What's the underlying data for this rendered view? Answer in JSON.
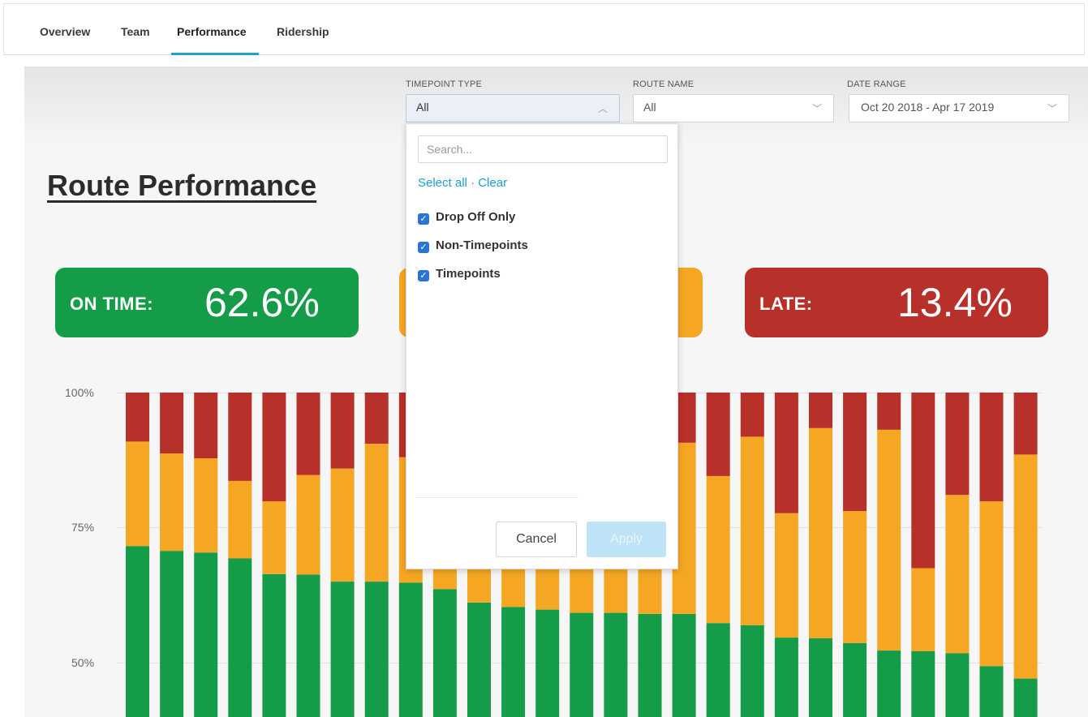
{
  "tabs": [
    {
      "label": "Overview"
    },
    {
      "label": "Team"
    },
    {
      "label": "Performance",
      "active": true
    },
    {
      "label": "Ridership"
    }
  ],
  "filters": {
    "timepoint": {
      "label": "TIMEPOINT TYPE",
      "value": "All"
    },
    "route": {
      "label": "ROUTE NAME",
      "value": "All"
    },
    "date": {
      "label": "DATE RANGE",
      "value": "Oct 20 2018 - Apr 17 2019"
    }
  },
  "dropdown": {
    "search_placeholder": "Search...",
    "select_all": "Select all",
    "separator": "·",
    "clear": "Clear",
    "options": [
      {
        "label": "Drop Off Only",
        "checked": true
      },
      {
        "label": "Non-Timepoints",
        "checked": true
      },
      {
        "label": "Timepoints",
        "checked": true
      }
    ],
    "cancel": "Cancel",
    "apply": "Apply"
  },
  "page_title": "Route Performance",
  "stats": {
    "on_time": {
      "label": "ON TIME:",
      "value": "62.6%",
      "color": "#149c48"
    },
    "early": {
      "color": "#f5a623"
    },
    "late": {
      "label": "LATE:",
      "value": "13.4%",
      "color": "#b8302a"
    }
  },
  "chart_data": {
    "type": "bar",
    "stacked": true,
    "y_ticks": [
      "100%",
      "75%",
      "50%"
    ],
    "ylim": [
      40,
      100
    ],
    "grid": true,
    "series": [
      {
        "color": "#149c48",
        "values": [
          71.5,
          70.6,
          70.3,
          69.2,
          66.3,
          66.2,
          64.9,
          64.9,
          64.7,
          63.5,
          61.0,
          60.2,
          59.7,
          59.1,
          59.1,
          58.9,
          58.9,
          57.2,
          56.8,
          54.5,
          54.4,
          53.5,
          52.1,
          52.0,
          51.6,
          49.2,
          46.9
        ]
      },
      {
        "color": "#f5a623",
        "values": [
          19.4,
          18.1,
          17.5,
          14.4,
          13.5,
          18.5,
          21.0,
          25.6,
          23.3,
          26.2,
          28.0,
          29.0,
          30.2,
          30.6,
          30.5,
          31.2,
          31.8,
          27.3,
          35.0,
          23.1,
          39.0,
          24.5,
          41.0,
          15.4,
          29.4,
          30.6,
          41.6
        ]
      },
      {
        "color": "#b8302a",
        "values": [
          9.1,
          11.3,
          12.2,
          16.4,
          20.2,
          15.3,
          14.1,
          9.5,
          12.0,
          10.3,
          11.0,
          10.8,
          10.1,
          10.3,
          10.4,
          9.9,
          9.3,
          15.5,
          8.2,
          22.4,
          6.6,
          22.0,
          6.9,
          32.6,
          19.0,
          20.2,
          11.5
        ]
      }
    ]
  }
}
